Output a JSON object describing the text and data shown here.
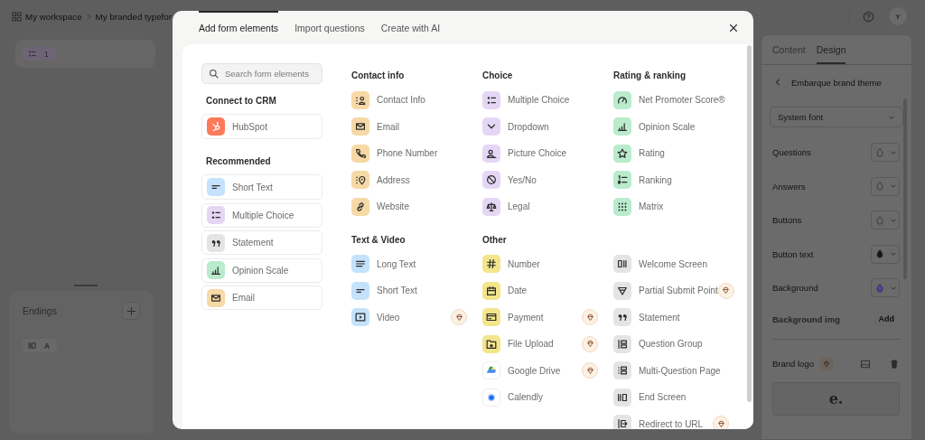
{
  "header": {
    "breadcrumb": [
      "My workspace",
      "My branded typefor"
    ],
    "avatar": "Y"
  },
  "questions_panel": {
    "items": [
      {
        "number": "1"
      }
    ]
  },
  "endings_panel": {
    "title": "Endings",
    "items": [
      {
        "label": "A"
      }
    ]
  },
  "design_panel": {
    "tabs": [
      {
        "label": "Content",
        "selected": false
      },
      {
        "label": "Design",
        "selected": true
      }
    ],
    "theme": "Embarque brand theme",
    "font": "System font",
    "color_rows": [
      {
        "label": "Questions",
        "color": "#6b6b6b"
      },
      {
        "label": "Answers",
        "color": "#6b6b6b"
      },
      {
        "label": "Buttons",
        "color": "#6b6b6b"
      },
      {
        "label": "Button text",
        "color": "#161616"
      },
      {
        "label": "Background",
        "color": "#4a44a6"
      }
    ],
    "background_image": {
      "label": "Background img",
      "button": "Add"
    },
    "brand_logo": {
      "label": "Brand logo",
      "premium": true,
      "logo": "e."
    }
  },
  "modal": {
    "tabs": [
      {
        "label": "Add form elements",
        "selected": true
      },
      {
        "label": "Import questions",
        "selected": false
      },
      {
        "label": "Create with AI",
        "selected": false
      }
    ],
    "search": {
      "placeholder": "Search form elements"
    },
    "sidebar_sections": [
      {
        "title": "Connect to CRM",
        "items": [
          {
            "label": "HubSpot",
            "color": "#ff7a59"
          }
        ]
      },
      {
        "title": "Recommended",
        "items": [
          {
            "label": "Short Text",
            "color": "#c4e2fb"
          },
          {
            "label": "Multiple Choice",
            "color": "#e6d6f5"
          },
          {
            "label": "Statement",
            "color": "#e4e4e4"
          },
          {
            "label": "Opinion Scale",
            "color": "#b9ebcc"
          },
          {
            "label": "Email",
            "color": "#f6d9a6"
          }
        ]
      }
    ],
    "columns": [
      {
        "sections": [
          {
            "title": "Contact info",
            "items": [
              {
                "label": "Contact Info",
                "color": "#f6d9a6",
                "premium": false
              },
              {
                "label": "Email",
                "color": "#f6d9a6",
                "premium": false
              },
              {
                "label": "Phone Number",
                "color": "#f6d9a6",
                "premium": false
              },
              {
                "label": "Address",
                "color": "#f6d9a6",
                "premium": false
              },
              {
                "label": "Website",
                "color": "#f6d9a6",
                "premium": false
              }
            ]
          },
          {
            "title": "Text & Video",
            "items": [
              {
                "label": "Long Text",
                "color": "#c4e2fb",
                "premium": false
              },
              {
                "label": "Short Text",
                "color": "#c4e2fb",
                "premium": false
              },
              {
                "label": "Video",
                "color": "#c4e2fb",
                "premium": true
              }
            ]
          }
        ]
      },
      {
        "sections": [
          {
            "title": "Choice",
            "items": [
              {
                "label": "Multiple Choice",
                "color": "#e6d6f5",
                "premium": false
              },
              {
                "label": "Dropdown",
                "color": "#e6d6f5",
                "premium": false
              },
              {
                "label": "Picture Choice",
                "color": "#e6d6f5",
                "premium": false
              },
              {
                "label": "Yes/No",
                "color": "#e6d6f5",
                "premium": false
              },
              {
                "label": "Legal",
                "color": "#e6d6f5",
                "premium": false
              }
            ]
          },
          {
            "title": "Other",
            "items": [
              {
                "label": "Number",
                "color": "#f3e58c",
                "premium": false
              },
              {
                "label": "Date",
                "color": "#f3e58c",
                "premium": false
              },
              {
                "label": "Payment",
                "color": "#f3e58c",
                "premium": true
              },
              {
                "label": "File Upload",
                "color": "#f3e58c",
                "premium": true
              },
              {
                "label": "Google Drive",
                "color": "#ffffff",
                "premium": true
              },
              {
                "label": "Calendly",
                "color": "#ffffff",
                "premium": false
              }
            ]
          }
        ]
      },
      {
        "sections": [
          {
            "title": "Rating & ranking",
            "items": [
              {
                "label": "Net Promoter Score®",
                "color": "#b9ebcc",
                "premium": false
              },
              {
                "label": "Opinion Scale",
                "color": "#b9ebcc",
                "premium": false
              },
              {
                "label": "Rating",
                "color": "#b9ebcc",
                "premium": false
              },
              {
                "label": "Ranking",
                "color": "#b9ebcc",
                "premium": false
              },
              {
                "label": "Matrix",
                "color": "#b9ebcc",
                "premium": false
              }
            ]
          },
          {
            "items": [
              {
                "label": "Welcome Screen",
                "color": "#e4e4e4",
                "premium": false
              },
              {
                "label": "Partial Submit Point",
                "color": "#e4e4e4",
                "premium": true
              },
              {
                "label": "Statement",
                "color": "#e4e4e4",
                "premium": false
              },
              {
                "label": "Question Group",
                "color": "#e4e4e4",
                "premium": false
              },
              {
                "label": "Multi-Question Page",
                "color": "#e4e4e4",
                "premium": false
              },
              {
                "label": "End Screen",
                "color": "#e4e4e4",
                "premium": false
              },
              {
                "label": "Redirect to URL",
                "color": "#e4e4e4",
                "premium": true
              }
            ]
          }
        ]
      }
    ]
  }
}
